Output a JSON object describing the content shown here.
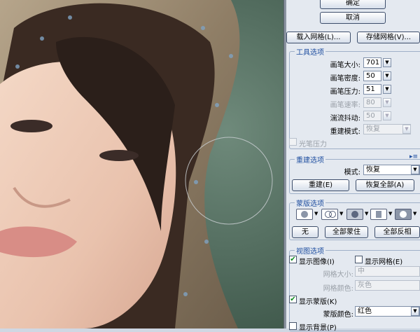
{
  "buttons": {
    "ok": "确定",
    "cancel": "取消",
    "load_mesh": "载入网格(L)...",
    "save_mesh": "存储网格(V)..."
  },
  "tool_options": {
    "title": "工具选项",
    "brush_size_label": "画笔大小:",
    "brush_size_value": "701",
    "brush_density_label": "画笔密度:",
    "brush_density_value": "50",
    "brush_pressure_label": "画笔压力:",
    "brush_pressure_value": "51",
    "brush_rate_label": "画笔速率:",
    "brush_rate_value": "80",
    "turbulent_jitter_label": "湍流抖动:",
    "turbulent_jitter_value": "50",
    "reconstruct_mode_label": "重建模式:",
    "reconstruct_mode_value": "恢复",
    "stylus_pressure_label": "光笔压力"
  },
  "reconstruct_options": {
    "title": "重建选项",
    "mode_label": "模式:",
    "mode_value": "恢复",
    "reconstruct_button": "重建(E)",
    "restore_all_button": "恢复全部(A)"
  },
  "mask_options": {
    "title": "蒙版选项",
    "none_button": "无",
    "mask_all_button": "全部蒙住",
    "invert_all_button": "全部反相"
  },
  "view_options": {
    "title": "视图选项",
    "show_image_label": "显示图像(I)",
    "show_image_checked": true,
    "show_mesh_label": "显示网格(E)",
    "show_mesh_checked": false,
    "mesh_size_label": "网格大小:",
    "mesh_size_value": "中",
    "mesh_color_label": "网格颜色:",
    "mesh_color_value": "灰色",
    "show_mask_label": "显示蒙版(K)",
    "show_mask_checked": true,
    "mask_color_label": "蒙版颜色:",
    "mask_color_value": "红色",
    "show_backdrop_label": "显示背景(P)",
    "show_backdrop_checked": false
  },
  "icons": {
    "checked_glyph": "✔",
    "dropdown_glyph": "▼",
    "panel_menu_glyph": "▸≡"
  },
  "colors": {
    "group_title": "#1f4fa0",
    "panel_bg": "#e4e9f0",
    "check_green": "#0a8a1a"
  }
}
